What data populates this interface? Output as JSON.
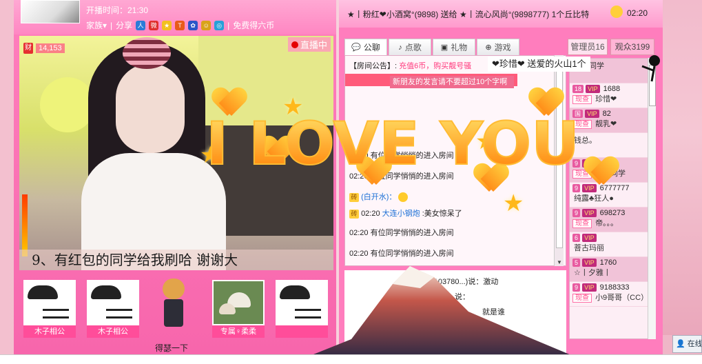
{
  "header": {
    "broadcast_time": "开播时间：21:30",
    "family_label": "家族▾",
    "share_label": "分享",
    "free_label": "免费得六币"
  },
  "video": {
    "wealth_value": "14,153",
    "wealth_icon": "财",
    "live_label": "直播中",
    "ticker_text": "9、有红包的同学给我刷哈   谢谢大"
  },
  "users_strip": {
    "cards": [
      {
        "caption": "木子相公"
      },
      {
        "caption": "木子相公"
      },
      {
        "caption": "专属♀柔柔"
      },
      {
        "caption": ""
      }
    ],
    "chibi_label": "得瑟一下"
  },
  "gift_banner": {
    "text": "★丨粉红❤小酒窝°(9898) 送给 ★丨流心风尚°(9898777) 1个丘比特",
    "time": "02:20"
  },
  "tabs": [
    {
      "label": "公聊",
      "icon": "chat-icon"
    },
    {
      "label": "点歌",
      "icon": "music-icon"
    },
    {
      "label": "礼物",
      "icon": "gift-icon"
    },
    {
      "label": "游戏",
      "icon": "game-icon"
    }
  ],
  "admin_tab": "管理员16",
  "viewers_tab": "观众3199",
  "chat": {
    "announce_label": "【房间公告】:",
    "announce_text": "充值6币，购买靓号骚",
    "warning": "新朋友的发言请不要超过10个字啊",
    "lines": [
      {
        "time": "02:20",
        "text": "有位同学悄悄的进入房间"
      },
      {
        "time": "02:20",
        "text": "有位同学悄悄的进入房间"
      },
      {
        "time": "",
        "text": "(白开水)："
      },
      {
        "time": "02:20",
        "user": "大连小钢炮",
        "text": ":美女惊呆了"
      },
      {
        "time": "02:20",
        "text": "有位同学悄悄的进入房间"
      },
      {
        "time": "02:20",
        "text": "有位同学悄悄的进入房间"
      }
    ],
    "lower_lines": [
      {
        "text": "(3103780...)说：激动"
      },
      {
        "text": "说："
      },
      {
        "text": "就是谁"
      }
    ]
  },
  "gift_overlay": "❤珍惜❤  送爱的火山1个",
  "user_list": [
    {
      "level": "",
      "name": "木子同学",
      "num": ""
    },
    {
      "level": "VIP",
      "name": "珍惜❤",
      "num": "1688"
    },
    {
      "level": "VIP",
      "name": "靓乳❤",
      "num": "82"
    },
    {
      "level": "",
      "name": "钱总。",
      "num": ""
    },
    {
      "level": "VIP",
      "name": "后排同学",
      "num": ""
    },
    {
      "level": "VIP",
      "name": "纯露♣狂人●",
      "num": "6777777"
    },
    {
      "level": "VIP",
      "name": "帝。。。",
      "num": "698273"
    },
    {
      "level": "VIP",
      "name": "菩古玛丽",
      "num": ""
    },
    {
      "level": "VIP",
      "name": "☆丨夕雅丨",
      "num": "1760"
    },
    {
      "level": "VIP",
      "name": "小9哥哥（CC）",
      "num": "9188333"
    }
  ],
  "tag_label": "现查",
  "overlay_text": "I LOVE YOU",
  "status_text": "在线",
  "colors": {
    "accent": "#ff5ba3",
    "link": "#1a6fd6",
    "warning": "#ff3a7d"
  }
}
